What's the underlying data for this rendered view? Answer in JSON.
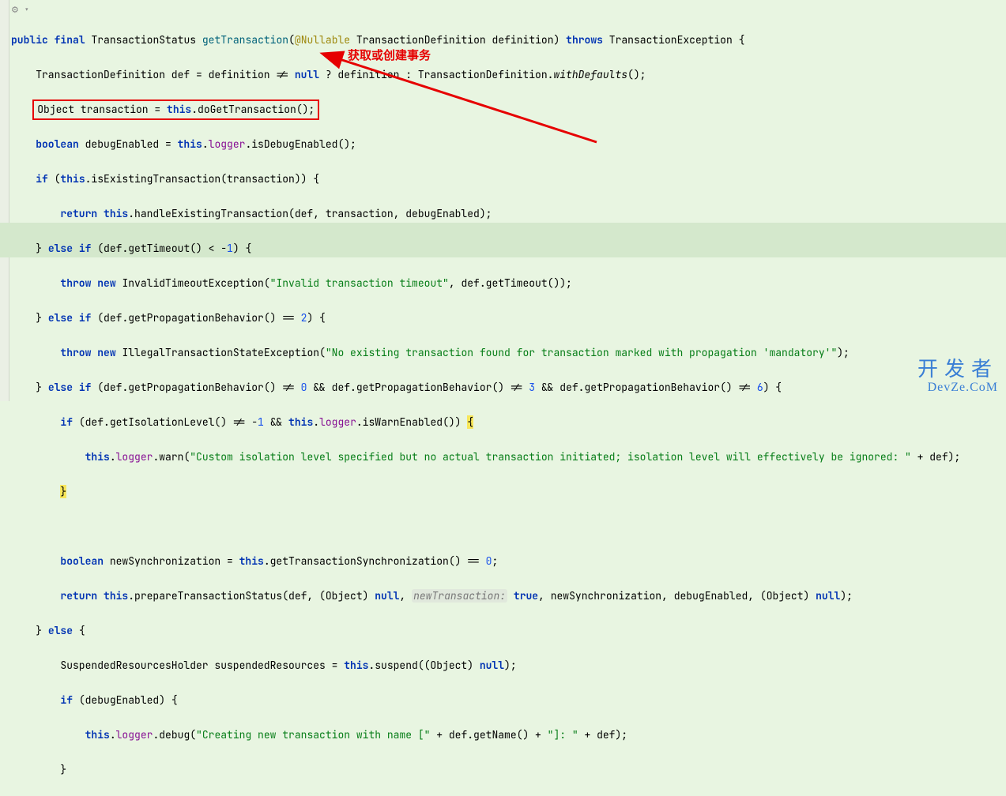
{
  "toolbar": {
    "icon": "⚙ ▾"
  },
  "annotation": {
    "text": "获取或创建事务"
  },
  "watermark": {
    "cn": "开发者",
    "en": "DevZe.CoM"
  },
  "code": {
    "l1": {
      "kw1": "public",
      "kw2": "final",
      "type1": "TransactionStatus",
      "method": "getTransaction",
      "anno": "@Nullable",
      "type2": "TransactionDefinition",
      "param": "definition",
      "kw3": "throws",
      "type3": "TransactionException"
    },
    "l2": {
      "t1": "TransactionDefinition def = definition != ",
      "null1": "null",
      "t2": " ? definition : TransactionDefinition.",
      "call": "withDefaults",
      "t3": "();"
    },
    "l3": {
      "t1": "Object transaction = ",
      "this": "this",
      "t2": ".doGetTransaction();"
    },
    "l4": {
      "kw": "boolean",
      "t1": " debugEnabled = ",
      "this": "this",
      "t2": ".",
      "field": "logger",
      "t3": ".isDebugEnabled();"
    },
    "l5": {
      "kw": "if",
      "t1": " (",
      "this": "this",
      "t2": ".isExistingTransaction(transaction)) {"
    },
    "l6": {
      "kw1": "return",
      "this": "this",
      "t1": ".handleExistingTransaction(def, transaction, debugEnabled);"
    },
    "l7": {
      "t1": "} ",
      "kw1": "else",
      "kw2": "if",
      "t2": " (def.getTimeout() < -",
      "num": "1",
      "t3": ") {"
    },
    "l8": {
      "kw1": "throw",
      "kw2": "new",
      "t1": " InvalidTimeoutException(",
      "str": "\"Invalid transaction timeout\"",
      "t2": ", def.getTimeout());"
    },
    "l9": {
      "t1": "} ",
      "kw1": "else",
      "kw2": "if",
      "t2": " (def.getPropagationBehavior() == ",
      "num": "2",
      "t3": ") {"
    },
    "l10": {
      "kw1": "throw",
      "kw2": "new",
      "t1": " IllegalTransactionStateException(",
      "str": "\"No existing transaction found for transaction marked with propagation 'mandatory'\"",
      "t2": ");"
    },
    "l11": {
      "t1": "} ",
      "kw1": "else",
      "kw2": "if",
      "t2": " (def.getPropagationBehavior() != ",
      "n1": "0",
      "t3": " && def.getPropagationBehavior() != ",
      "n2": "3",
      "t4": " && def.getPropagationBehavior() != ",
      "n3": "6",
      "t5": ") {"
    },
    "l12": {
      "kw": "if",
      "t1": " (def.getIsolationLevel() != -",
      "n1": "1",
      "t2": " && ",
      "this": "this",
      "t3": ".",
      "field": "logger",
      "t4": ".isWarnEnabled()) "
    },
    "l13": {
      "this": "this",
      "t1": ".",
      "field": "logger",
      "t2": ".warn(",
      "str": "\"Custom isolation level specified but no actual transaction initiated; isolation level will effectively be ignored: \"",
      "t3": " + def);"
    },
    "l14": {
      "brace": "}"
    },
    "l16": {
      "kw": "boolean",
      "t1": " newSynchronization = ",
      "this": "this",
      "t2": ".getTransactionSynchronization() == ",
      "num": "0",
      "t3": ";"
    },
    "l17": {
      "kw1": "return",
      "this": "this",
      "t1": ".prepareTransactionStatus(def, (Object) ",
      "null1": "null",
      "t2": ", ",
      "hint": "newTransaction:",
      "val": "true",
      "t3": ", newSynchronization, debugEnabled, (Object) ",
      "null2": "null",
      "t4": ");"
    },
    "l18": {
      "t1": "} ",
      "kw": "else",
      "t2": " {"
    },
    "l19": {
      "t1": "SuspendedResourcesHolder suspendedResources = ",
      "this": "this",
      "t2": ".suspend((Object) ",
      "null1": "null",
      "t3": ");"
    },
    "l20": {
      "kw": "if",
      "t1": " (debugEnabled) {"
    },
    "l21": {
      "this": "this",
      "t1": ".",
      "field": "logger",
      "t2": ".debug(",
      "str1": "\"Creating new transaction with name [\"",
      "t3": " + def.getName() + ",
      "str2": "\"]: \"",
      "t4": " + def);"
    },
    "l22": {
      "brace": "}"
    }
  }
}
